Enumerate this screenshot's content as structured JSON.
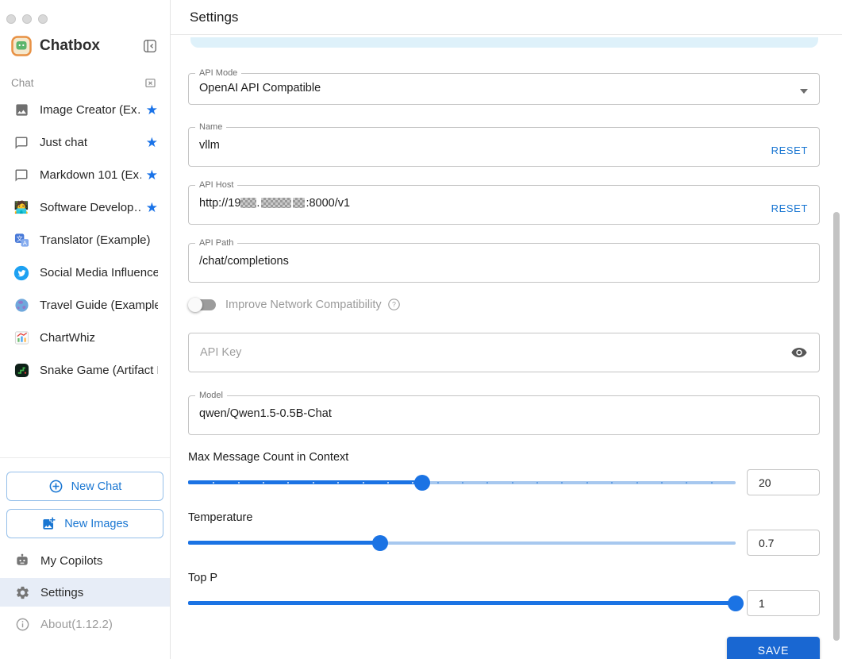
{
  "sidebar": {
    "app_title": "Chatbox",
    "section_label": "Chat",
    "sessions": [
      {
        "name": "image-creator",
        "icon": "image-icon",
        "label": "Image Creator (Ex…",
        "starred": true
      },
      {
        "name": "just-chat",
        "icon": "chat-bubble-icon",
        "label": "Just chat",
        "starred": true
      },
      {
        "name": "markdown-101",
        "icon": "chat-bubble-icon",
        "label": "Markdown 101 (Ex…",
        "starred": true
      },
      {
        "name": "software-developer",
        "icon": "technologist-emoji-icon",
        "label": "Software Develop…",
        "starred": true
      },
      {
        "name": "translator",
        "icon": "translate-icon",
        "label": "Translator (Example)",
        "starred": false
      },
      {
        "name": "social-media-influencer",
        "icon": "twitter-icon",
        "label": "Social Media Influencer …",
        "starred": false
      },
      {
        "name": "travel-guide",
        "icon": "globe-emoji-icon",
        "label": "Travel Guide (Example)",
        "starred": false
      },
      {
        "name": "chartwhiz",
        "icon": "chart-emoji-icon",
        "label": "ChartWhiz",
        "starred": false
      },
      {
        "name": "snake-game",
        "icon": "game-icon",
        "label": "Snake Game (Artifact E…",
        "starred": false
      }
    ],
    "buttons": {
      "new_chat_label": "New Chat",
      "new_images_label": "New Images"
    },
    "nav": [
      {
        "name": "my-copilots",
        "icon": "robot-icon",
        "label": "My Copilots",
        "active": false,
        "muted": false
      },
      {
        "name": "settings",
        "icon": "gear-icon",
        "label": "Settings",
        "active": true,
        "muted": false
      },
      {
        "name": "about",
        "icon": "info-icon",
        "label": "About(1.12.2)",
        "active": false,
        "muted": true
      }
    ]
  },
  "settings": {
    "title": "Settings",
    "api_mode": {
      "label": "API Mode",
      "value": "OpenAI API Compatible"
    },
    "name": {
      "label": "Name",
      "value": "vllm",
      "reset_label": "RESET"
    },
    "api_host": {
      "label": "API Host",
      "visible_prefix": "http://19",
      "visible_suffix": ":8000/v1",
      "redacted": true,
      "reset_label": "RESET"
    },
    "api_path": {
      "label": "API Path",
      "value": "/chat/completions"
    },
    "network_toggle": {
      "label": "Improve Network Compatibility",
      "state": "off"
    },
    "api_key": {
      "placeholder": "API Key"
    },
    "model": {
      "label": "Model",
      "value": "qwen/Qwen1.5-0.5B-Chat"
    },
    "sliders": [
      {
        "name": "max-message-count",
        "label": "Max Message Count in Context",
        "value": "20",
        "percent": 42.7,
        "ticks": true
      },
      {
        "name": "temperature",
        "label": "Temperature",
        "value": "0.7",
        "percent": 35,
        "ticks": false
      },
      {
        "name": "top-p",
        "label": "Top P",
        "value": "1",
        "percent": 100,
        "ticks": false
      }
    ],
    "save_label": "SAVE"
  },
  "colors": {
    "primary_blue": "#1976d2",
    "slider_fill": "#1b73e4",
    "slider_rail": "#a7c8ef",
    "save_button": "#1967d2",
    "active_nav_bg": "#e7edf7",
    "tab_remnant": "#def1fa"
  }
}
